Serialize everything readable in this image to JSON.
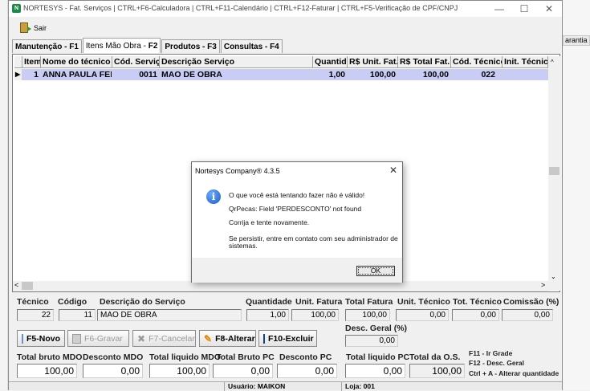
{
  "window": {
    "title": "NORTESYS - Fat. Serviços | CTRL+F6-Calculadora | CTRL+F11-Calendário | CTRL+F12-Faturar | CTRL+F5-Verificação de CPF/CNPJ",
    "minimize": "—",
    "maximize": "☐",
    "close": "✕"
  },
  "background": {
    "garantia": "arantia"
  },
  "toolbar": {
    "sair": "Sair"
  },
  "tabs": [
    {
      "label": "Manutenção - F1"
    },
    {
      "label_a": "Itens Mão Obra - ",
      "label_b": "F2"
    },
    {
      "label": "Produtos - F3"
    },
    {
      "label": "Consultas - F4"
    }
  ],
  "grid": {
    "columns": [
      "Item",
      "Nome do técnico",
      "Cód. Serviço",
      "Descrição Serviço",
      "Quantid.",
      "R$ Unit. Fat.",
      "R$ Total Fat.",
      "Cód. Técnico",
      "Init. Técnico"
    ],
    "rows": [
      {
        "indicator": "▶",
        "item": "1",
        "tecnico": "ANNA PAULA FERN/",
        "cod_servico": "0011",
        "descricao": "MAO DE OBRA",
        "quantidade": "1,00",
        "unit": "100,00",
        "total": "100,00",
        "cod_tecnico": "022",
        "init": ""
      }
    ]
  },
  "form": {
    "tecnico_label": "Técnico",
    "tecnico": "22",
    "codigo_label": "Código",
    "codigo": "11",
    "descricao_label": "Descrição do Serviço",
    "descricao": "MAO DE OBRA",
    "quantidade_label": "Quantidade",
    "quantidade": "1,00",
    "unit_fatura_label": "Unit. Fatura",
    "unit_fatura": "100,00",
    "total_fatura_label": "Total Fatura",
    "total_fatura": "100,00",
    "unit_tecnico_label": "Unit. Técnico",
    "unit_tecnico": "0,00",
    "tot_tecnico_label": "Tot. Técnico",
    "tot_tecnico": "0,00",
    "comissao_label": "Comissão (%)",
    "comissao": "0,00",
    "desc_geral_label": "Desc. Geral (%)",
    "desc_geral": "0,00"
  },
  "buttons": {
    "novo": "F5-Novo",
    "gravar": "F6-Gravar",
    "cancelar": "F7-Cancelar",
    "alterar": "F8-Alterar",
    "excluir": "F10-Excluir"
  },
  "totals": {
    "bruto_mdo_label": "Total bruto MDO",
    "bruto_mdo": "100,00",
    "desconto_mdo_label": "Desconto MDO",
    "desconto_mdo": "0,00",
    "liquido_mdo_label": "Total liquido MDO",
    "liquido_mdo": "100,00",
    "bruto_pc_label": "Total Bruto PC",
    "bruto_pc": "0,00",
    "desconto_pc_label": "Desconto PC",
    "desconto_pc": "0,00",
    "liquido_pc_label": "Total liquido PC",
    "liquido_pc": "0,00",
    "total_os_label": "Total da O.S.",
    "total_os": "100,00"
  },
  "shortcuts": [
    "F11 - Ir Grade",
    "F12 - Desc. Geral",
    "Ctrl + A - Alterar quantidade"
  ],
  "status": {
    "usuario": "Usuário: MAIKON",
    "loja": "Loja: 001"
  },
  "dialog": {
    "title": "Nortesys Company® 4.3.5",
    "close": "✕",
    "message1": "O que você está tentando fazer não é válido!",
    "message2": "QrPecas: Field 'PERDESCONTO' not found",
    "message3": "Corrija e tente novamente.",
    "message4a": "Se persistir, entre em contato com seu administrador de",
    "message4b": "sistemas.",
    "ok": "OK"
  }
}
